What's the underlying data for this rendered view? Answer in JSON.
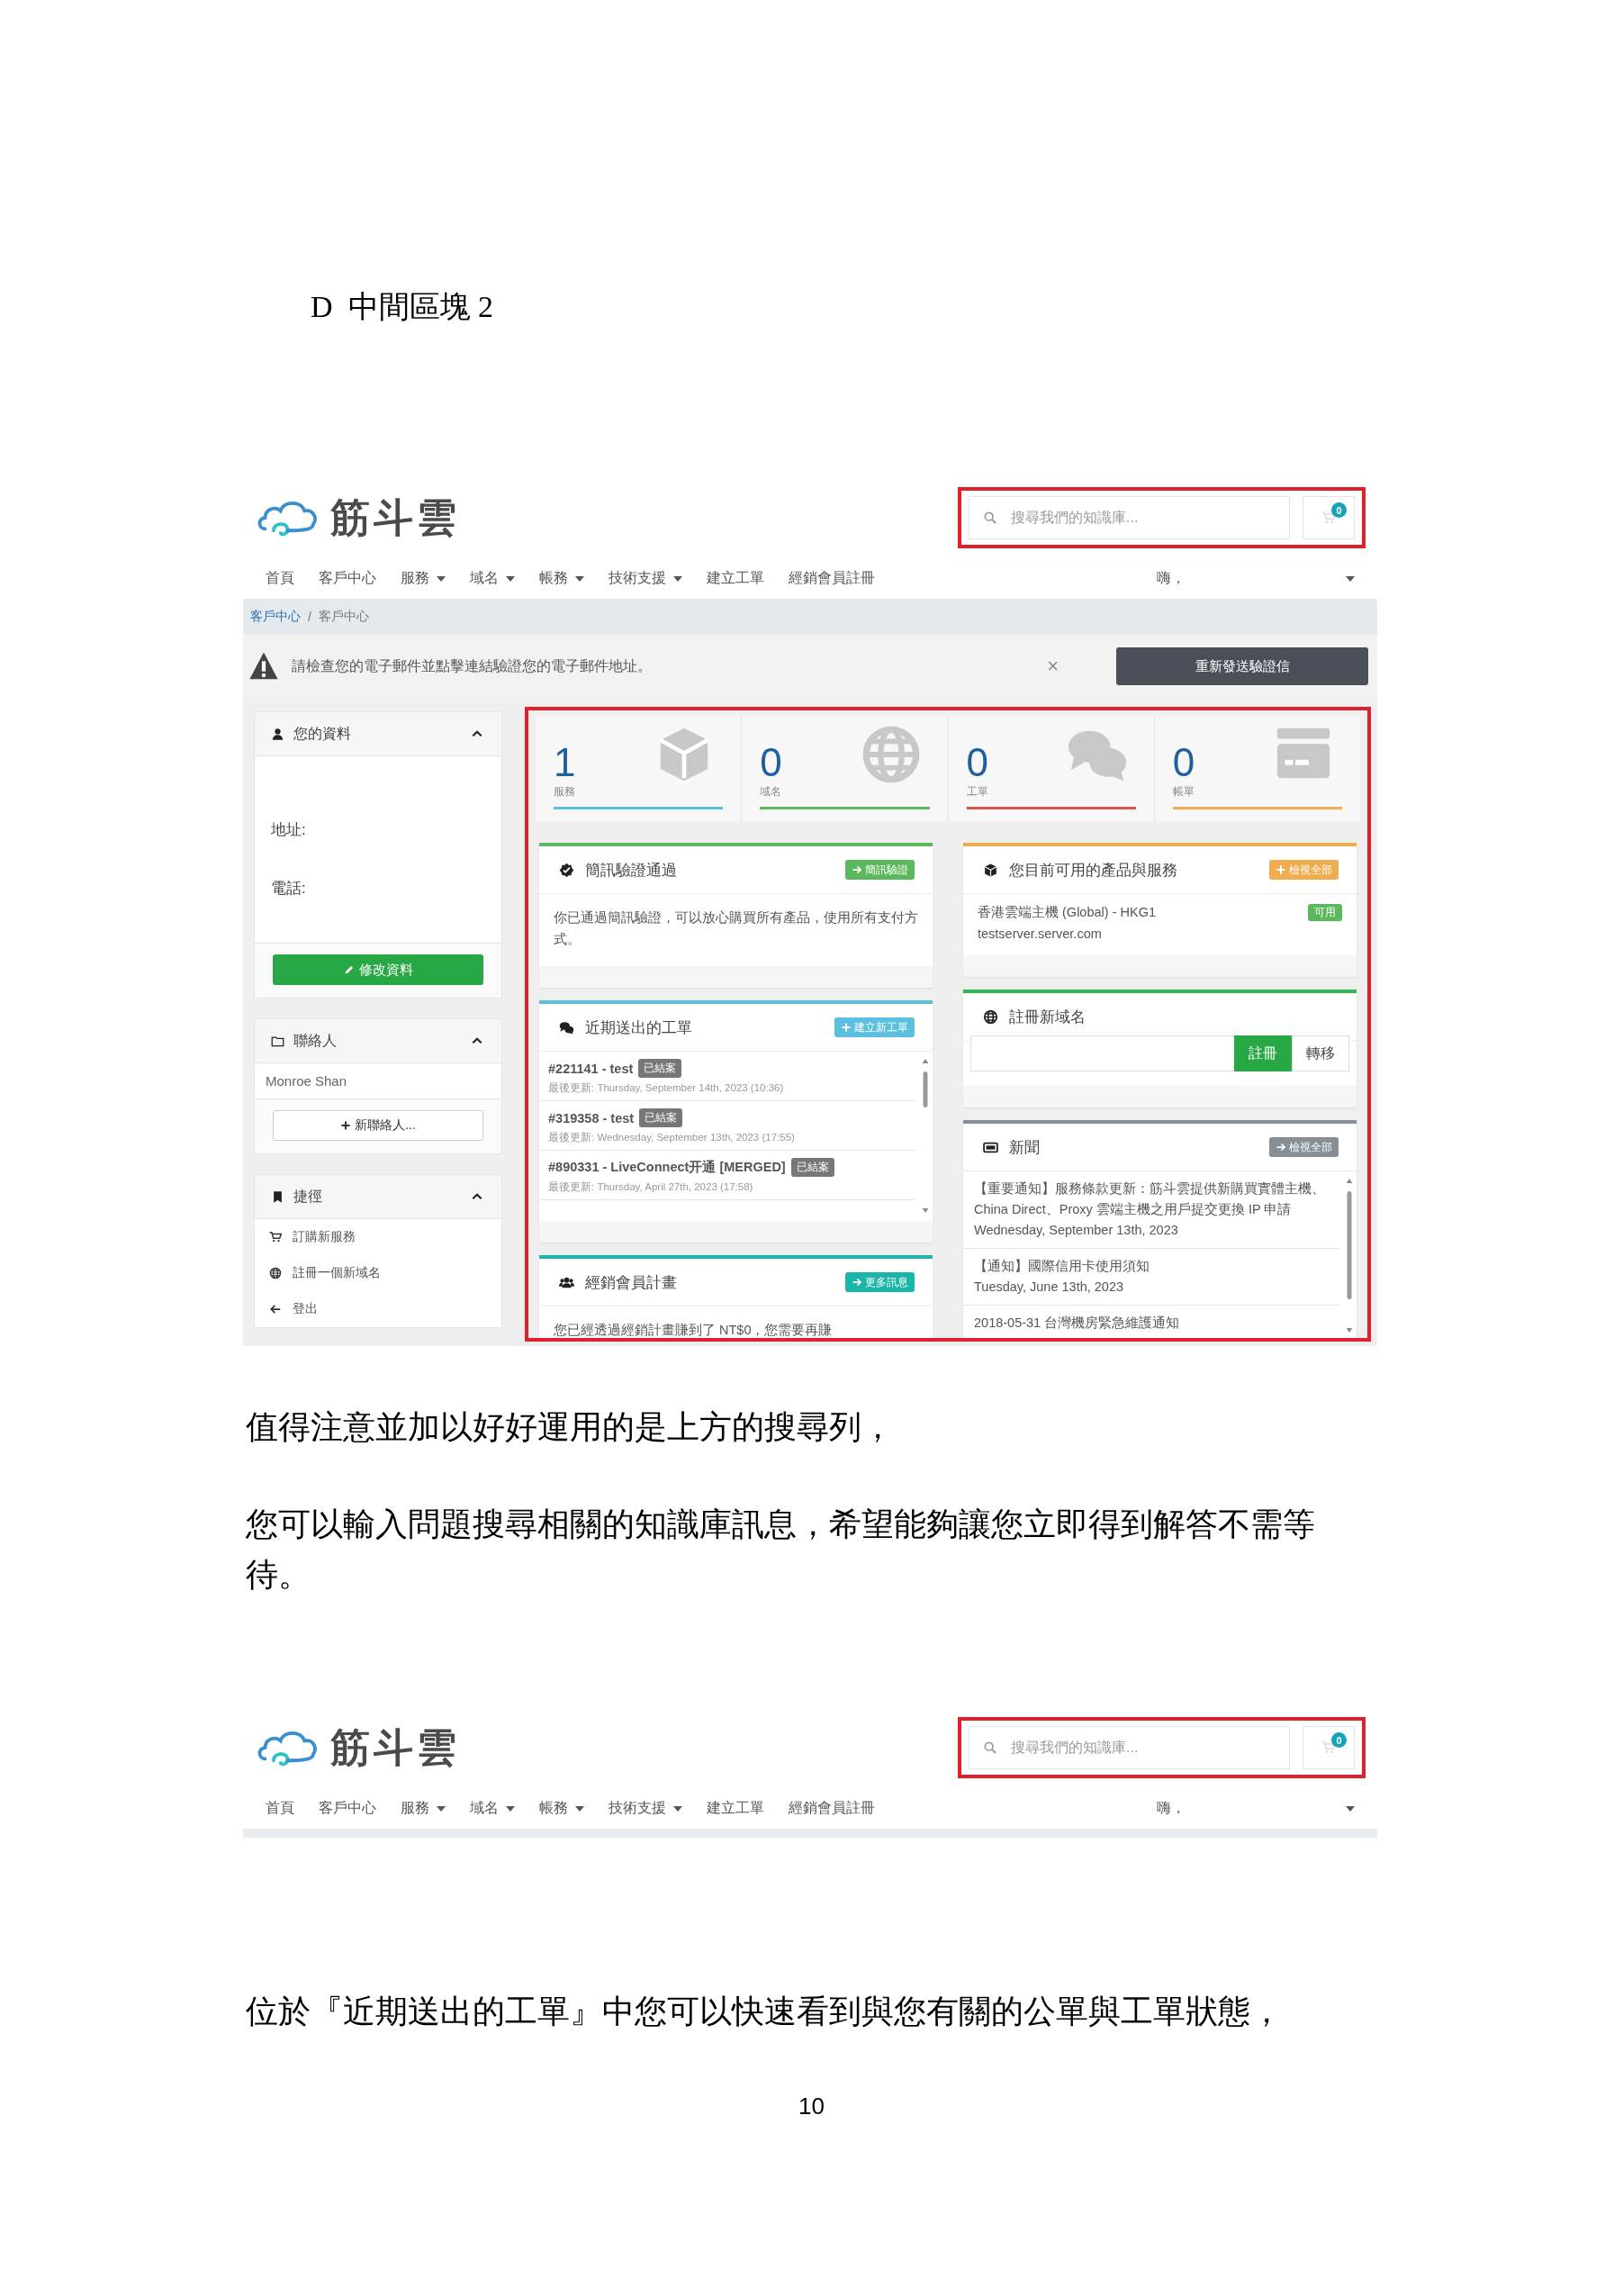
{
  "heading": "D  中間區塊 2",
  "screenshot_1": {
    "header": {
      "logo_text": "筋斗雲",
      "search": {
        "placeholder": "搜尋我們的知識庫..."
      },
      "cart_count": "0"
    },
    "nav": {
      "items": [
        {
          "label": "首頁",
          "dropdown": false
        },
        {
          "label": "客戶中心",
          "dropdown": false
        },
        {
          "label": "服務",
          "dropdown": true
        },
        {
          "label": "域名",
          "dropdown": true
        },
        {
          "label": "帳務",
          "dropdown": true
        },
        {
          "label": "技術支援",
          "dropdown": true
        },
        {
          "label": "建立工單",
          "dropdown": false
        },
        {
          "label": "經銷會員註冊",
          "dropdown": false
        }
      ],
      "greeting": {
        "label": "嗨，",
        "dropdown": true
      }
    },
    "breadcrumb": {
      "items": [
        "客戶中心",
        "客戶中心"
      ],
      "separator": "/"
    },
    "alert": {
      "message": "請檢查您的電子郵件並點擊連結驗證您的電子郵件地址。",
      "close": "×",
      "button": "重新發送驗證信"
    },
    "sidebar": {
      "profile": {
        "title": "您的資料",
        "fields": [
          "地址:",
          "電話:"
        ],
        "button": "修改資料"
      },
      "contacts": {
        "title": "聯絡人",
        "items": [
          "Monroe Shan"
        ],
        "button": "新聯絡人..."
      },
      "shortcuts": {
        "title": "捷徑",
        "items": [
          "訂購新服務",
          "註冊一個新域名",
          "登出"
        ]
      }
    },
    "stats": [
      {
        "value": "1",
        "label": "服務",
        "color": "#5bc0de"
      },
      {
        "value": "0",
        "label": "域名",
        "color": "#5cb85c"
      },
      {
        "value": "0",
        "label": "工單",
        "color": "#d9534f"
      },
      {
        "value": "0",
        "label": "帳單",
        "color": "#f0ad4e"
      }
    ],
    "left_panels": [
      {
        "kind": "text",
        "title": "簡訊驗證通過",
        "color": "#5cb85c",
        "button": "簡訊驗證",
        "text": "你已通過簡訊驗證，可以放心購買所有產品，使用所有支付方式。"
      },
      {
        "kind": "tickets",
        "title": "近期送出的工單",
        "color": "#5bc0de",
        "button": "建立新工單",
        "tickets": [
          {
            "title": "#221141 - test",
            "status": "已結案",
            "updated": "最後更新: Thursday, September 14th, 2023 (10:36)"
          },
          {
            "title": "#319358 - test",
            "status": "已結案",
            "updated": "最後更新: Wednesday, September 13th, 2023 (17:55)"
          },
          {
            "title": "#890331 - LiveConnect开通 [MERGED]",
            "status": "已結案",
            "updated": "最後更新: Thursday, April 27th, 2023 (17:58)"
          }
        ]
      },
      {
        "kind": "text",
        "title": "經銷會員計畫",
        "color": "#1bb5aa",
        "button": "更多訊息",
        "text": "您已經透過經銷計畫賺到了 NT$0，您需要再賺"
      }
    ],
    "right_panels": [
      {
        "kind": "products",
        "title": "您目前可用的產品與服務",
        "color": "#f0ad4e",
        "button": "檢視全部",
        "products": [
          {
            "name": "香港雲端主機 (Global) - HKG1",
            "domain": "testserver.server.com",
            "status": "可用"
          }
        ]
      },
      {
        "kind": "domain",
        "title": "註冊新域名",
        "color": "#2db84d",
        "actions": [
          "註冊",
          "轉移"
        ]
      },
      {
        "kind": "news",
        "title": "新聞",
        "color": "#868e96",
        "button": "檢視全部",
        "news": [
          {
            "title": "【重要通知】服務條款更新：筋斗雲提供新購買實體主機、China Direct、Proxy 雲端主機之用戶提交更換 IP 申請",
            "date": "Wednesday, September 13th, 2023"
          },
          {
            "title": "【通知】國際信用卡使用須知",
            "date": "Tuesday, June 13th, 2023"
          },
          {
            "title": "2018-05-31 台灣機房緊急維護通知"
          }
        ]
      }
    ]
  },
  "paragraph_1": "值得注意並加以好好運用的是上方的搜尋列，",
  "paragraph_2": "您可以輸入問題搜尋相關的知識庫訊息，希望能夠讓您立即得到解答不需等待。",
  "screenshot_2": {
    "header": {
      "logo_text": "筋斗雲",
      "search": {
        "placeholder": "搜尋我們的知識庫..."
      },
      "cart_count": "0"
    },
    "nav": {
      "items": [
        {
          "label": "首頁",
          "dropdown": false
        },
        {
          "label": "客戶中心",
          "dropdown": false
        },
        {
          "label": "服務",
          "dropdown": true
        },
        {
          "label": "域名",
          "dropdown": true
        },
        {
          "label": "帳務",
          "dropdown": true
        },
        {
          "label": "技術支援",
          "dropdown": true
        },
        {
          "label": "建立工單",
          "dropdown": false
        },
        {
          "label": "經銷會員註冊",
          "dropdown": false
        }
      ],
      "greeting": {
        "label": "嗨，",
        "dropdown": true
      }
    }
  },
  "paragraph_3": "位於『近期送出的工單』中您可以快速看到與您有關的公單與工單狀態，",
  "page_number": "10"
}
